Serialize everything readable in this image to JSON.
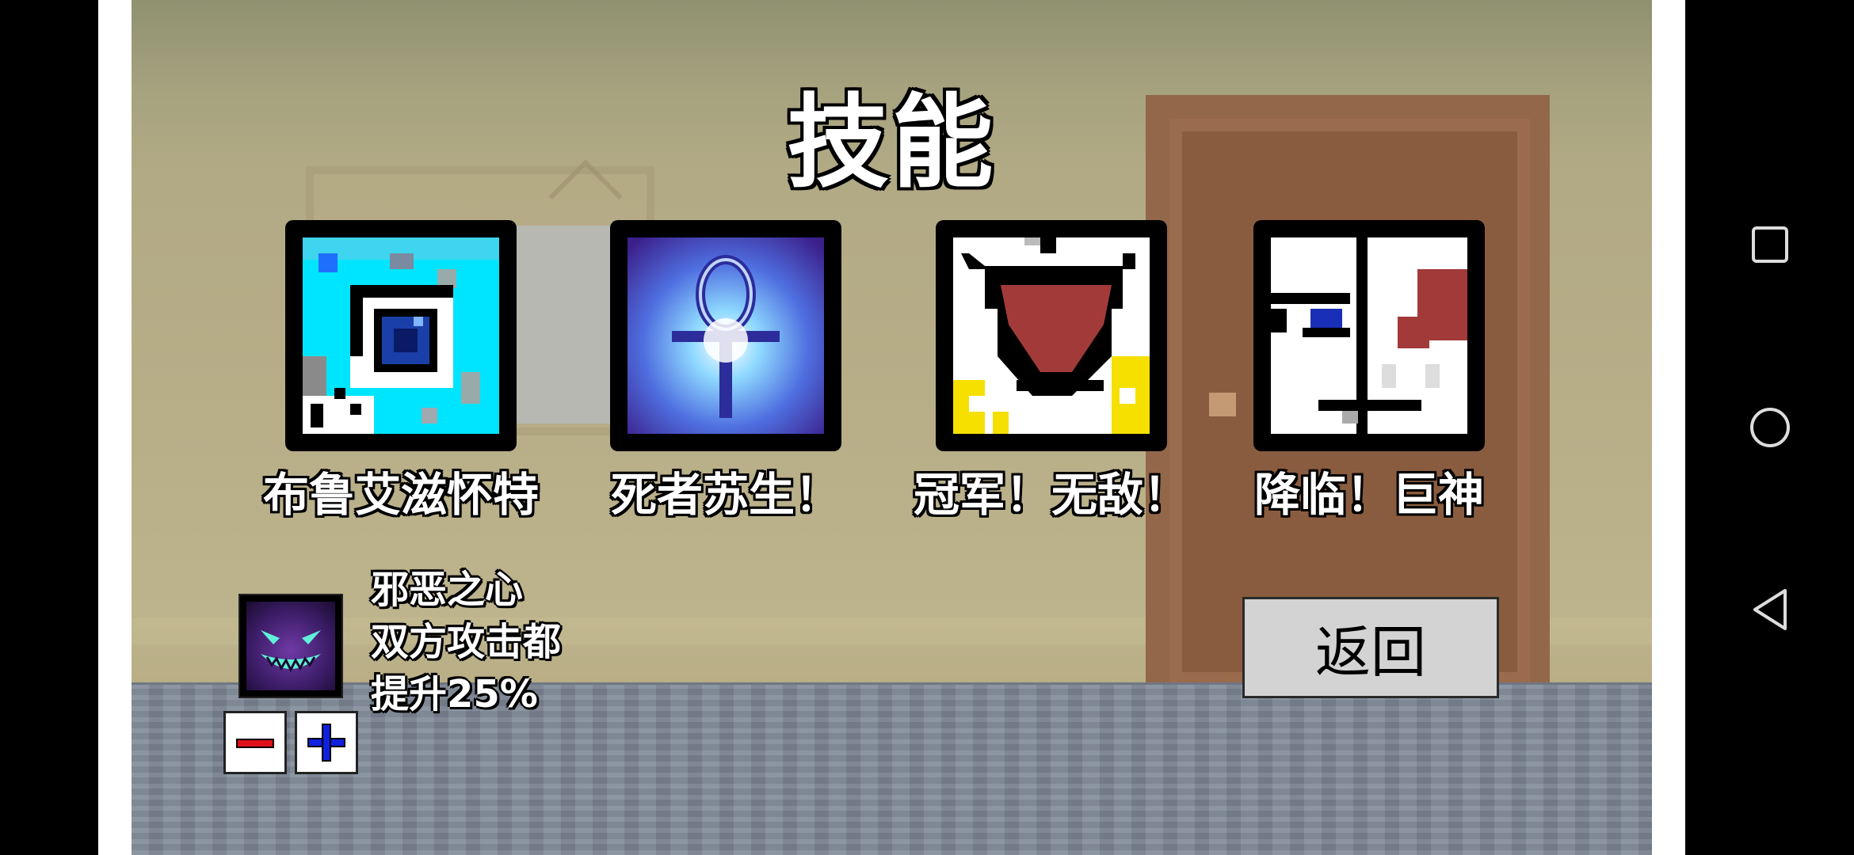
{
  "title": "技能",
  "skills": [
    {
      "label": "布鲁艾滋怀特",
      "icon": "eye-skill-icon"
    },
    {
      "label": "死者苏生！",
      "icon": "ankh-skill-icon"
    },
    {
      "label": "冠军！无敌！",
      "icon": "champion-skill-icon"
    },
    {
      "label": "降临！巨神",
      "icon": "giant-face-skill-icon"
    }
  ],
  "selected": {
    "icon": "evil-heart-icon",
    "lines": [
      "邪恶之心",
      "双方攻击都",
      "提升25%"
    ]
  },
  "controls": {
    "minus": "−",
    "plus": "+"
  },
  "back_label": "返回",
  "nav": {
    "recent": "square-icon",
    "home": "circle-icon",
    "back": "triangle-icon"
  }
}
